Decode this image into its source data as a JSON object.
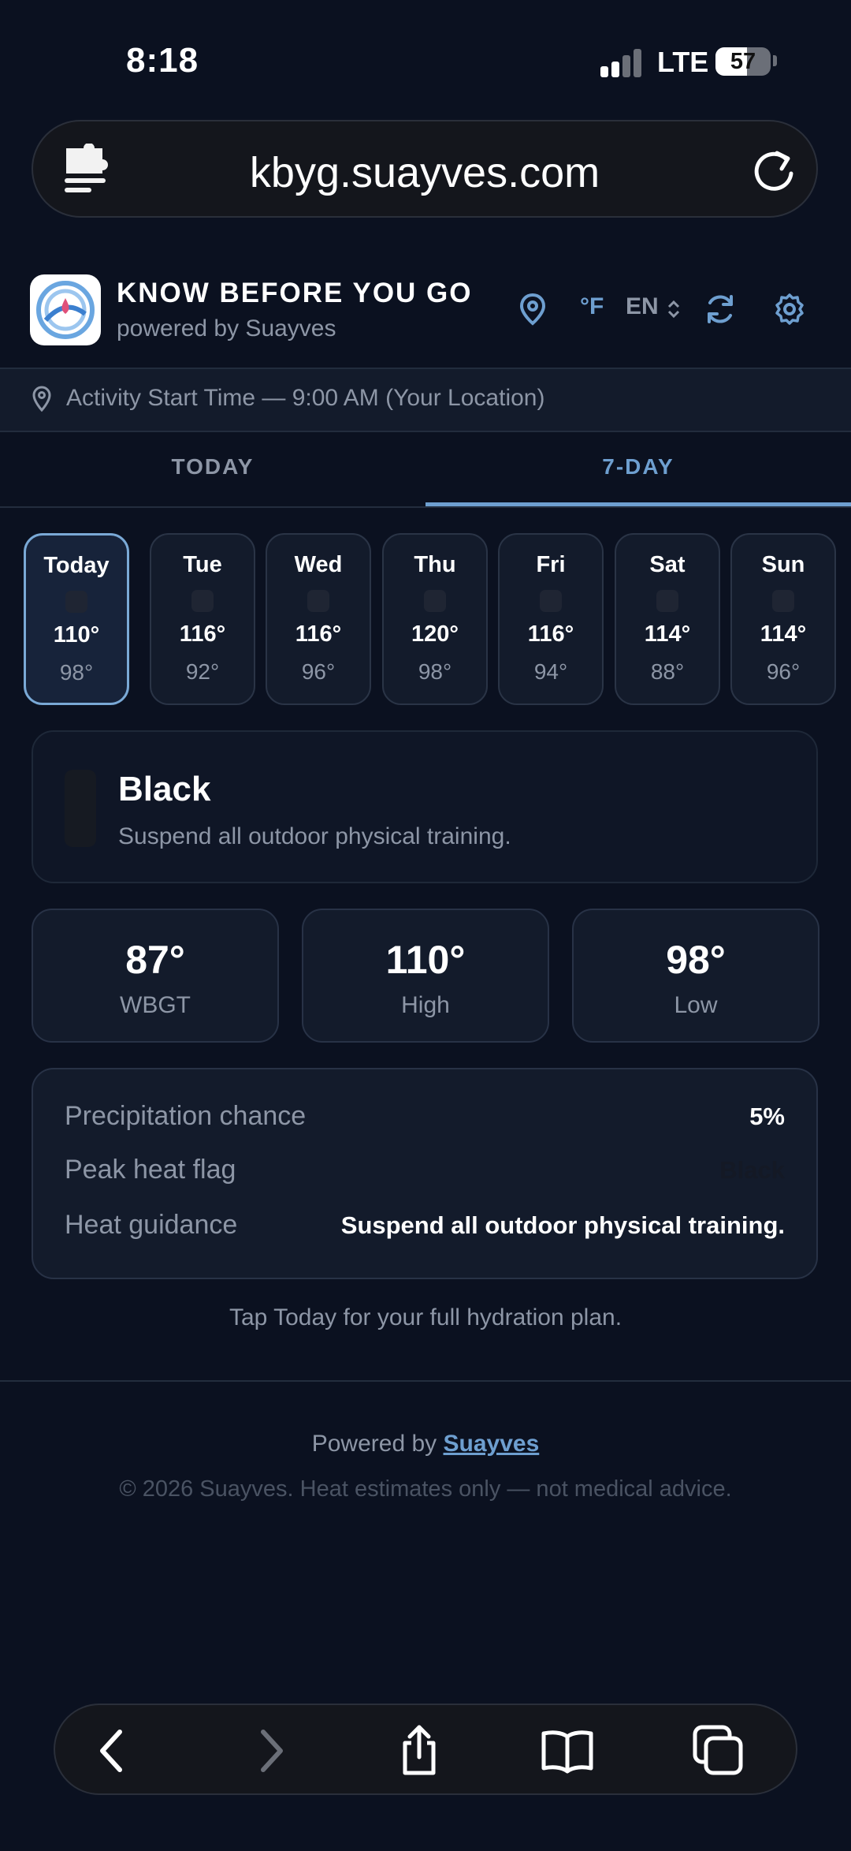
{
  "status_bar": {
    "time": "8:18",
    "network": "LTE",
    "battery_percent": "57",
    "battery_level": 0.57
  },
  "browser": {
    "url": "kbyg.suayves.com",
    "extension_icon": "puzzle-icon",
    "reload_icon": "reload-icon"
  },
  "app": {
    "title": "KNOW BEFORE YOU GO",
    "subtitle": "powered by Suayves",
    "unit_label": "°F",
    "language_label": "EN",
    "location_icon": "location-pin-icon",
    "refresh_icon": "refresh-icon",
    "settings_icon": "gear-icon"
  },
  "activity": {
    "text": "Activity Start Time — 9:00 AM (Your Location)"
  },
  "tabs": [
    {
      "label": "TODAY",
      "selected": false
    },
    {
      "label": "7-DAY",
      "selected": true
    }
  ],
  "days": [
    {
      "name": "Today",
      "high": "110°",
      "low": "98°",
      "selected": true
    },
    {
      "name": "Tue",
      "high": "116°",
      "low": "92°",
      "selected": false
    },
    {
      "name": "Wed",
      "high": "116°",
      "low": "96°",
      "selected": false
    },
    {
      "name": "Thu",
      "high": "120°",
      "low": "98°",
      "selected": false
    },
    {
      "name": "Fri",
      "high": "116°",
      "low": "94°",
      "selected": false
    },
    {
      "name": "Sat",
      "high": "114°",
      "low": "88°",
      "selected": false
    },
    {
      "name": "Sun",
      "high": "114°",
      "low": "96°",
      "selected": false
    }
  ],
  "flag": {
    "name": "Black",
    "description": "Suspend all outdoor physical training.",
    "color": "#161a22"
  },
  "stats": [
    {
      "value": "87°",
      "label": "WBGT"
    },
    {
      "value": "110°",
      "label": "High"
    },
    {
      "value": "98°",
      "label": "Low"
    }
  ],
  "details": [
    {
      "label": "Precipitation chance",
      "value": "5%"
    },
    {
      "label": "Peak heat flag",
      "value": "Black"
    },
    {
      "label": "Heat guidance",
      "value": "Suspend all outdoor physical training."
    }
  ],
  "hint": "Tap Today for your full hydration plan.",
  "footer": {
    "powered_prefix": "Powered by",
    "powered_link": "Suayves",
    "copyright": "© 2026 Suayves. Heat estimates only — not medical advice."
  },
  "colors": {
    "background": "#0b1120",
    "accent": "#6e9fd0",
    "muted_text": "#8d96a6"
  }
}
